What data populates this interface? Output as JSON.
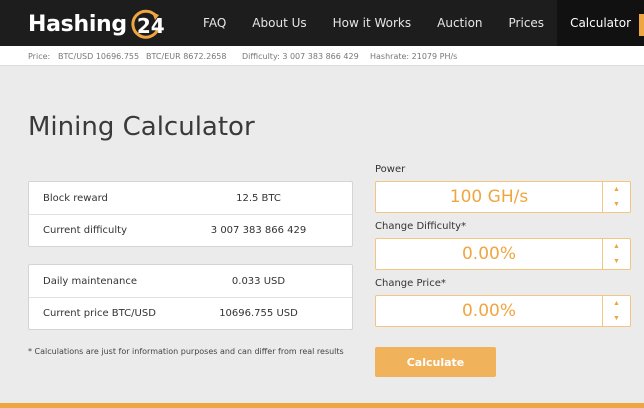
{
  "brand": {
    "logo_text": "Hashing",
    "logo_number": "24",
    "accent_color": "#f0a640"
  },
  "nav": {
    "items": [
      "FAQ",
      "About Us",
      "How it Works",
      "Auction",
      "Prices",
      "Calculator"
    ],
    "active": "Calculator"
  },
  "ticker": {
    "price_label": "Price:",
    "btc_usd": "BTC/USD 10696.755",
    "btc_eur": "BTC/EUR 8672.2658",
    "difficulty": "Difficulty: 3 007 383 866 429",
    "hashrate": "Hashrate: 21079 PH/s"
  },
  "page": {
    "title": "Mining Calculator"
  },
  "reward_card": {
    "rows": [
      {
        "label": "Block reward",
        "value": "12.5 BTC"
      },
      {
        "label": "Current difficulty",
        "value": "3 007 383 866 429"
      }
    ]
  },
  "cost_card": {
    "rows": [
      {
        "label": "Daily maintenance",
        "value": "0.033 USD"
      },
      {
        "label": "Current price BTC/USD",
        "value": "10696.755 USD"
      }
    ]
  },
  "disclaimer": "* Calculations are just for information purposes and can differ from real results",
  "form": {
    "power": {
      "label": "Power",
      "value": "100 GH/s"
    },
    "change_difficulty": {
      "label": "Change Difficulty*",
      "value": "0.00%"
    },
    "change_price": {
      "label": "Change Price*",
      "value": "0.00%"
    },
    "spinner_up": "▲",
    "spinner_down": "▼",
    "submit_label": "Calculate"
  }
}
